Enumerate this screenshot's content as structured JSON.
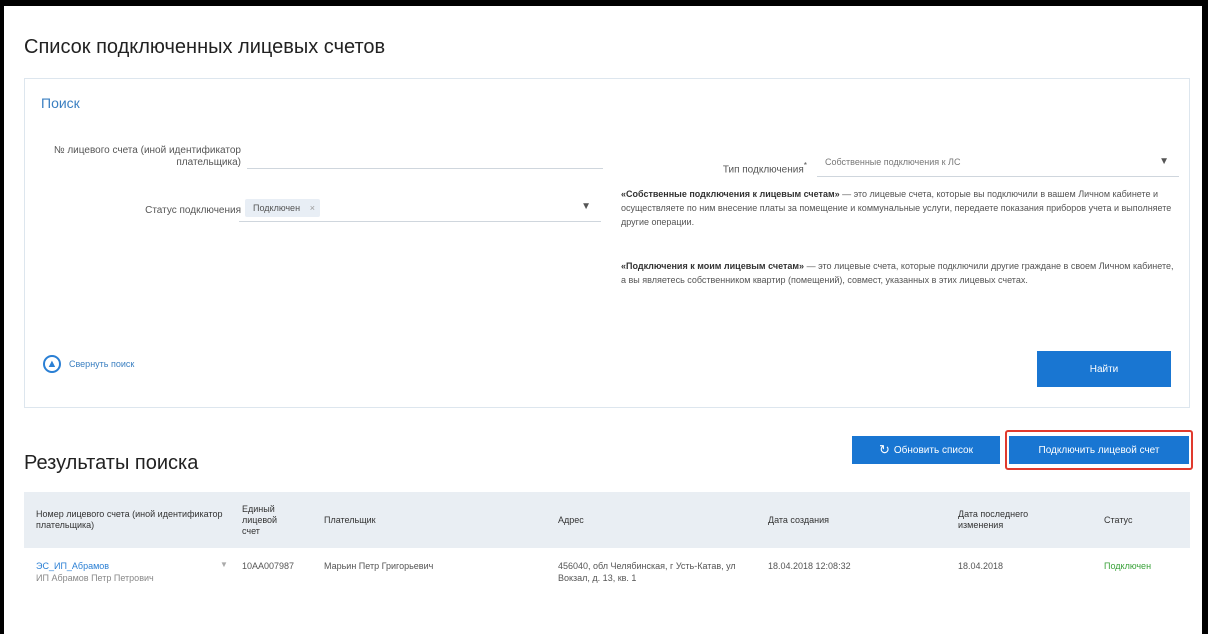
{
  "page_title": "Список подключенных лицевых счетов",
  "search": {
    "title": "Поиск",
    "account_label": "№ лицевого счета (иной идентификатор плательщика)",
    "account_value": "",
    "status_label": "Статус подключения",
    "status_chip": "Подключен",
    "status_chip_remove": "×",
    "connection_type_label": "Тип подключения",
    "required_mark": "*",
    "connection_type_value": "Собственные подключения к ЛС",
    "caret": "▼",
    "desc_own_title": "«Собственные подключения к лицевым счетам»",
    "desc_own_text": " — это лицевые счета, которые вы подключили в вашем Личном кабинете и осуществляете по ним внесение платы за помещение и коммунальные услуги, передаете показания приборов учета и выполняете другие операции.",
    "desc_mine_title": "«Подключения к моим лицевым счетам»",
    "desc_mine_text": " — это лицевые счета, которые подключили другие граждане в своем Личном кабинете, а вы являетесь собственником квартир (помещений), совмест, указанных в этих лицевых счетах.",
    "collapse_label": "Свернуть поиск",
    "find_button": "Найти"
  },
  "results": {
    "title": "Результаты поиска",
    "refresh_icon": "↻",
    "refresh_button": "Обновить список",
    "connect_button": "Подключить лицевой счет"
  },
  "table": {
    "headers": [
      "Номер лицевого счета (иной идентификатор плательщика)",
      "Единый лицевой счет",
      "Плательщик",
      "Адрес",
      "Дата создания",
      "Дата последнего изменения",
      "Статус"
    ],
    "rows": [
      {
        "account": "ЭС_ИП_Абрамов",
        "account_sub": "ИП Абрамов Петр Петрович",
        "els": "10АА007987",
        "payer": "Марьин Петр Григорьевич",
        "address": "456040, обл Челябинская, г Усть-Катав, ул Вокзал, д. 13, кв. 1",
        "created": "18.04.2018 12:08:32",
        "modified": "18.04.2018",
        "status": "Подключен"
      }
    ]
  },
  "colors": {
    "accent": "#1976d2",
    "highlight": "#e03a2e",
    "status_ok": "#3aa23a"
  }
}
